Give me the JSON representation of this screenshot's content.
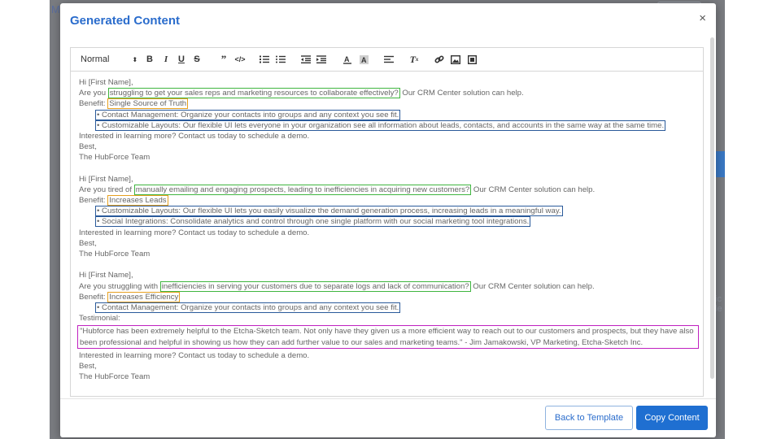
{
  "modal": {
    "title": "Generated Content",
    "close_label": "×"
  },
  "background": {
    "letter": "M",
    "side_text": [
      "ic",
      "le"
    ]
  },
  "toolbar": {
    "format_select": "Normal",
    "tools": [
      "bold-icon",
      "italic-icon",
      "underline-icon",
      "strikethrough-icon",
      "blockquote-icon",
      "code-icon",
      "ordered-list-icon",
      "bullet-list-icon",
      "outdent-icon",
      "indent-icon",
      "font-color-icon",
      "background-color-icon",
      "align-icon",
      "clear-format-icon",
      "link-icon",
      "image-icon",
      "video-icon"
    ]
  },
  "emails": [
    {
      "greeting": "Hi [First Name],",
      "question_pre": "Are you ",
      "pain_point": "struggling to get your sales reps and marketing resources to collaborate effectively?",
      "question_post": " Our CRM Center solution can help.",
      "benefit_label": "Benefit: ",
      "benefit": "Single Source of Truth",
      "features": [
        "• Contact Management: Organize your contacts into groups and any context you see fit.",
        "• Customizable Layouts: Our flexible UI lets everyone in your organization see all information about leads, contacts, and accounts in the same way at the same time."
      ],
      "cta": "Interested in learning more? Contact us today to schedule a demo.",
      "closing": "Best,",
      "signature": "The HubForce Team"
    },
    {
      "greeting": "Hi [First Name],",
      "question_pre": "Are you tired of ",
      "pain_point": "manually emailing and engaging prospects, leading to inefficiencies in acquiring new customers?",
      "question_post": " Our CRM Center solution can help.",
      "benefit_label": "Benefit: ",
      "benefit": "Increases Leads",
      "features": [
        "• Customizable Layouts: Our flexible UI lets you easily visualize the demand generation process, increasing leads in a meaningful way.",
        "• Social Integrations: Consolidate analytics and control through one single platform with our social marketing tool integrations."
      ],
      "cta": "Interested in learning more? Contact us today to schedule a demo.",
      "closing": "Best,",
      "signature": "The HubForce Team"
    },
    {
      "greeting": "Hi [First Name],",
      "question_pre": "Are you struggling with ",
      "pain_point": "inefficiencies in serving your customers due to separate logs and lack of communication?",
      "question_post": " Our CRM Center solution can help.",
      "benefit_label": "Benefit: ",
      "benefit": "Increases Efficiency",
      "features": [
        "• Contact Management: Organize your contacts into groups and any context you see fit."
      ],
      "testimonial_label": "Testimonial:",
      "testimonial": "\"Hubforce has been extremely helpful to the Etcha-Sketch team. Not only have they given us a more efficient way to reach out to our customers and prospects, but they have also been professional and helpful in showing us how they can add further value to our sales and marketing teams.\" - Jim Jamakowski, VP Marketing, Etcha-Sketch Inc.",
      "cta": "Interested in learning more? Contact us today to schedule a demo.",
      "closing": "Best,",
      "signature": "The HubForce Team"
    }
  ],
  "footer": {
    "back_label": "Back to Template",
    "copy_label": "Copy Content"
  },
  "colors": {
    "title": "#2a6ccc",
    "primary_button": "#1f6fd1",
    "pain_point_highlight": "#3fb53f",
    "benefit_highlight": "#e6a020",
    "feature_highlight": "#2a5a9a",
    "testimonial_highlight": "#c020c0"
  }
}
